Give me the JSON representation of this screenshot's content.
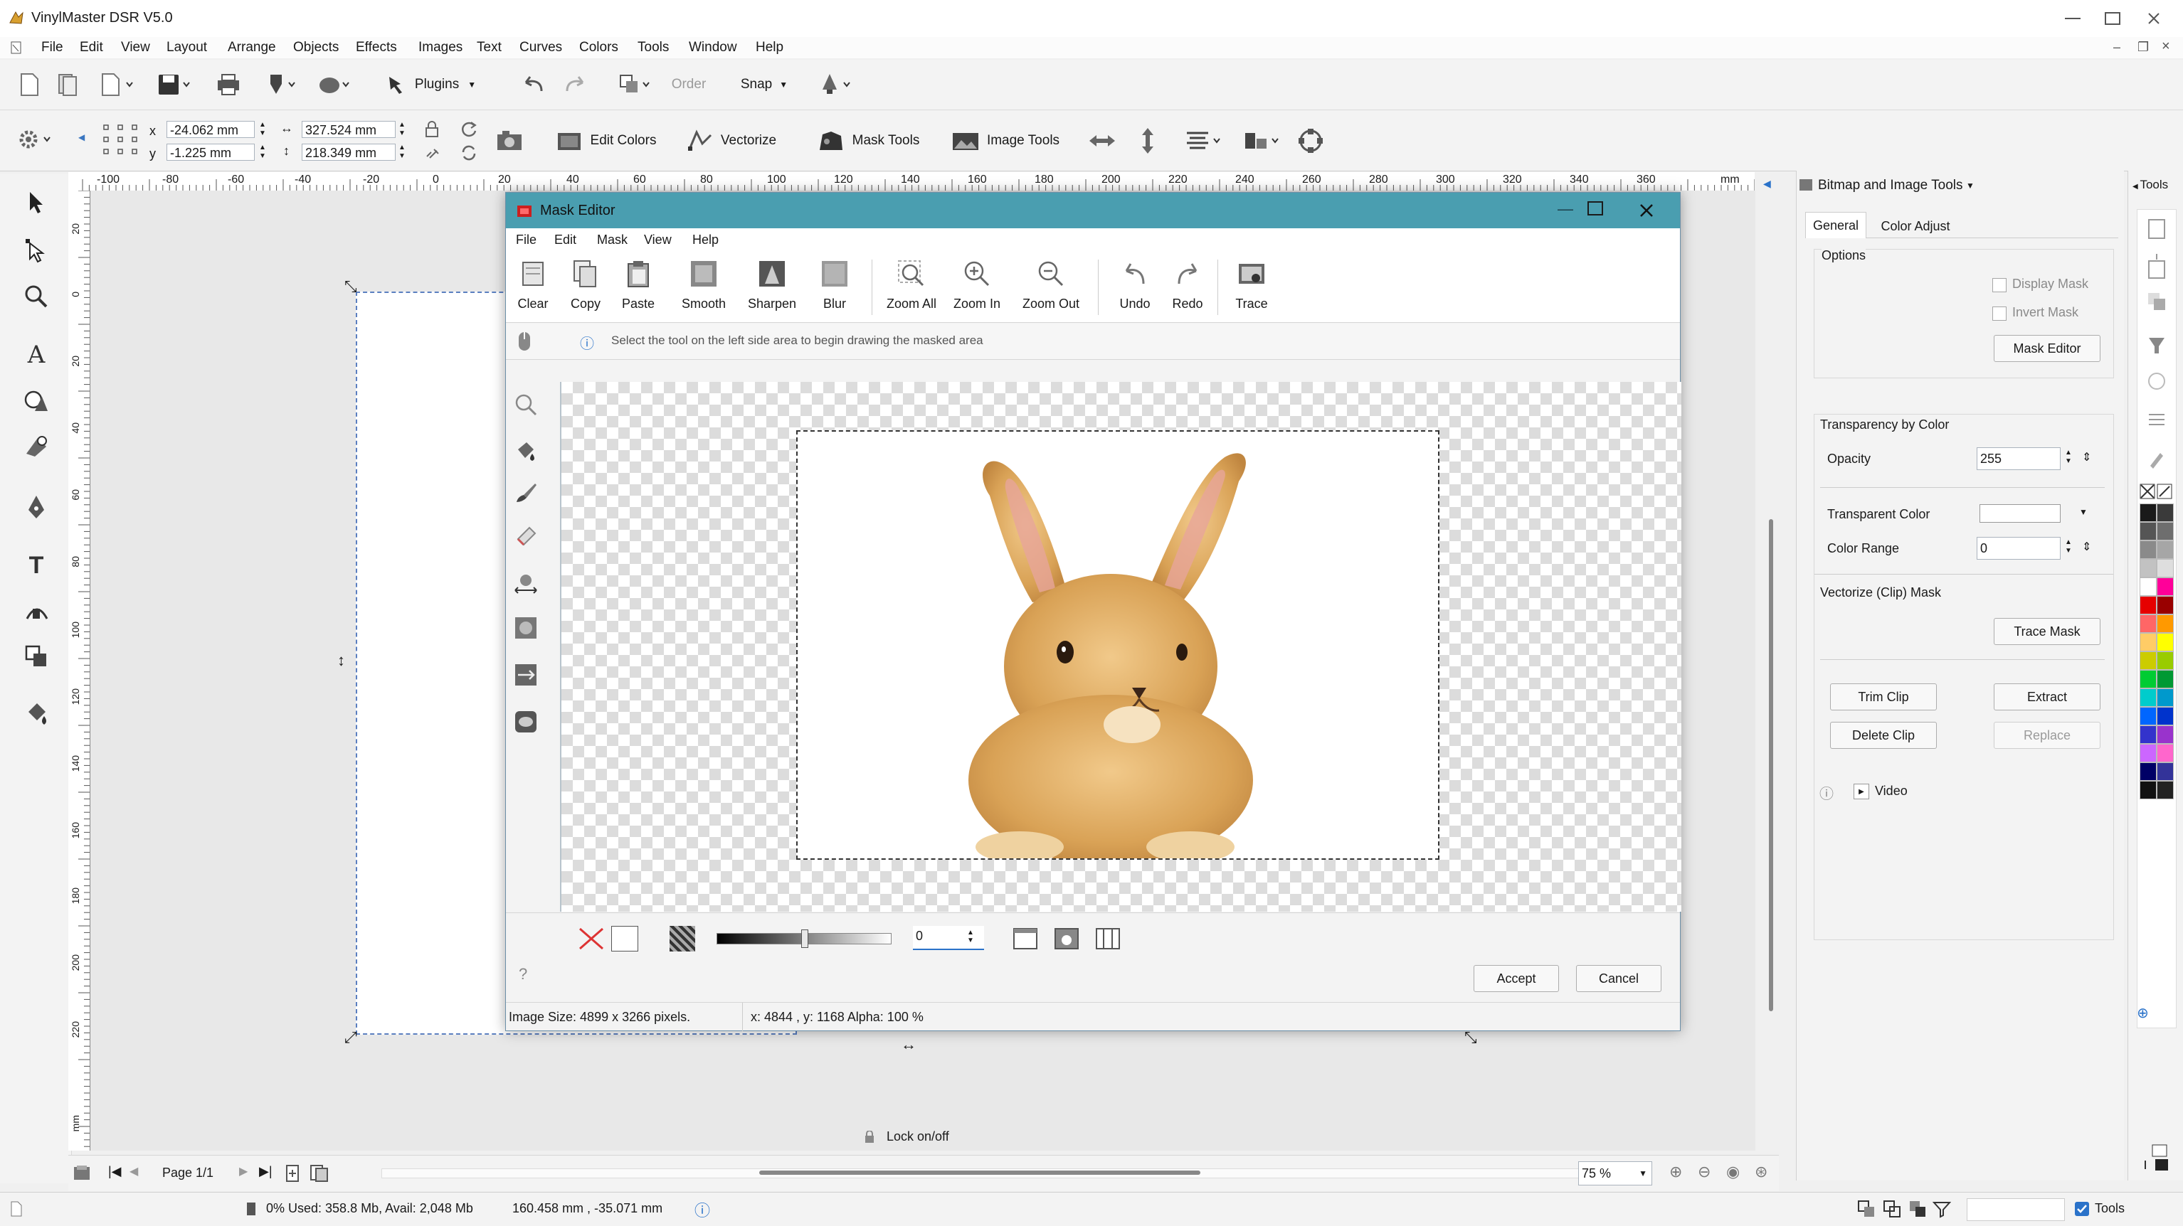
{
  "app": {
    "title": "VinylMaster DSR V5.0",
    "menu": [
      "File",
      "Edit",
      "View",
      "Layout",
      "Arrange",
      "Objects",
      "Effects",
      "Images",
      "Text",
      "Curves",
      "Colors",
      "Tools",
      "Window",
      "Help"
    ]
  },
  "toolbar": {
    "plugins_label": "Plugins",
    "order_label": "Order",
    "snap_label": "Snap"
  },
  "toolbar2": {
    "x_label": "x",
    "y_label": "y",
    "x_value": "-24.062 mm",
    "y_value": "-1.225 mm",
    "w_value": "327.524 mm",
    "h_value": "218.349 mm",
    "edit_colors": "Edit Colors",
    "vectorize": "Vectorize",
    "mask_tools": "Mask Tools",
    "image_tools": "Image Tools"
  },
  "ruler": {
    "h_ticks": [
      "-100",
      "-80",
      "-60",
      "-40",
      "-20",
      "0",
      "20",
      "40",
      "60",
      "80",
      "100",
      "120",
      "140",
      "160",
      "180",
      "200",
      "220",
      "240",
      "260",
      "280",
      "300",
      "320",
      "340",
      "360",
      "mm"
    ],
    "v_ticks": [
      "20",
      "0",
      "20",
      "40",
      "60",
      "80",
      "100",
      "120",
      "140",
      "160",
      "180",
      "200",
      "220",
      "mm"
    ]
  },
  "mask_editor": {
    "title": "Mask Editor",
    "menu": [
      "File",
      "Edit",
      "Mask",
      "View",
      "Help"
    ],
    "tools": [
      "Clear",
      "Copy",
      "Paste",
      "Smooth",
      "Sharpen",
      "Blur",
      "Zoom All",
      "Zoom In",
      "Zoom Out",
      "Undo",
      "Redo",
      "Trace"
    ],
    "hint": "Select the tool on the left side area to begin drawing the masked area",
    "level_value": "0",
    "accept": "Accept",
    "cancel": "Cancel",
    "status_size": "Image Size: 4899 x 3266 pixels.",
    "status_pos": "x: 4844 , y: 1168  Alpha: 100 %"
  },
  "right_panel": {
    "header": "Bitmap and Image Tools",
    "tabs": [
      "General",
      "Color Adjust"
    ],
    "options_title": "Options",
    "display_mask": "Display Mask",
    "invert_mask": "Invert Mask",
    "mask_editor_btn": "Mask Editor",
    "transparency_title": "Transparency by Color",
    "opacity_label": "Opacity",
    "opacity_value": "255",
    "transparent_color_label": "Transparent Color",
    "color_range_label": "Color Range",
    "color_range_value": "0",
    "vectorize_title": "Vectorize (Clip) Mask",
    "trace_mask": "Trace Mask",
    "trim_clip": "Trim Clip",
    "extract": "Extract",
    "delete_clip": "Delete Clip",
    "replace": "Replace",
    "video": "Video",
    "tools_tab": "Tools"
  },
  "palette": {
    "colors": [
      "#1a1a1a",
      "#3a3a3a",
      "#555555",
      "#6e6e6e",
      "#8a8a8a",
      "#a6a6a6",
      "#c2c2c2",
      "#dedede",
      "#ffffff",
      "#ff0099",
      "#e60000",
      "#990000",
      "#ff6666",
      "#ff9900",
      "#ffcc66",
      "#ffff00",
      "#cccc00",
      "#99cc00",
      "#00cc33",
      "#009933",
      "#00cccc",
      "#0099cc",
      "#0066ff",
      "#0033cc",
      "#3333cc",
      "#9933cc",
      "#cc66ff",
      "#ff66cc",
      "#000066",
      "#333399",
      "#111111",
      "#222222"
    ]
  },
  "canvas": {
    "lock_label": "Lock on/off",
    "page_label": "Page 1/1",
    "zoom_value": "75 %"
  },
  "status": {
    "memory": "0%  Used: 358.8 Mb, Avail: 2,048 Mb",
    "coords": "160.458 mm , -35.071 mm",
    "tools_label": "Tools"
  }
}
